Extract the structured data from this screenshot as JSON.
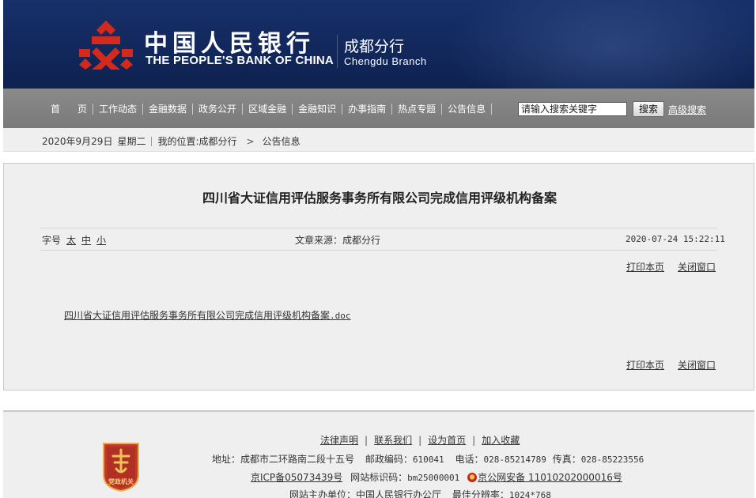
{
  "header": {
    "bank_name_cn": "中国人民银行",
    "bank_name_en": "THE PEOPLE'S BANK OF CHINA",
    "branch_cn": "成都分行",
    "branch_en": "Chengdu  Branch",
    "logo_icon": "pboc-logo-icon"
  },
  "nav": {
    "items": [
      "首页",
      "工作动态",
      "金融数据",
      "政务公开",
      "区域金融",
      "金融知识",
      "办事指南",
      "热点专题",
      "公告信息"
    ],
    "search_placeholder": "请输入搜索关键字",
    "search_button": "搜索",
    "advanced_search": "高级搜索"
  },
  "breadcrumb": {
    "date": "2020年9月29日",
    "weekday": "星期二",
    "location": "我的位置:成都分行",
    "current": "公告信息"
  },
  "article": {
    "title": "四川省大证信用评估服务事务所有限公司完成信用评级机构备案",
    "font_size_label": "字号",
    "font_sizes": [
      "太",
      "中",
      "小"
    ],
    "source": "文章来源：成都分行",
    "datetime": "2020-07-24 15:22:11",
    "print_label": "打印本页",
    "close_label": "关闭窗口",
    "attachment_name": "四川省大证信用评估服务事务所有限公司完成信用评级机构备案",
    "attachment_ext": ".doc"
  },
  "footer": {
    "links": [
      "法律声明",
      "联系我们",
      "设为首页",
      "加入收藏"
    ],
    "address": "地址：成都市二环路南二段十五号",
    "postcode_label": "邮政编码：",
    "postcode": "610041",
    "phone_label": "电话：",
    "phone": "028-85214789",
    "fax_label": "传真：",
    "fax": "028-85223556",
    "icp": "京ICP备05073439号",
    "site_id_label": "网站标识码：",
    "site_id": "bm25000001",
    "police": "京公网安备 11010202000016号",
    "host_label": "网站主办单位：中国人民银行办公厅",
    "resolution_label": "最佳分辨率：",
    "resolution": "1024*768",
    "badge_text": "党政机关",
    "badge_icon": "party-government-badge-icon"
  },
  "colors": {
    "banner": "#12285c",
    "nav": "#808080",
    "badge": "#c0392b"
  }
}
